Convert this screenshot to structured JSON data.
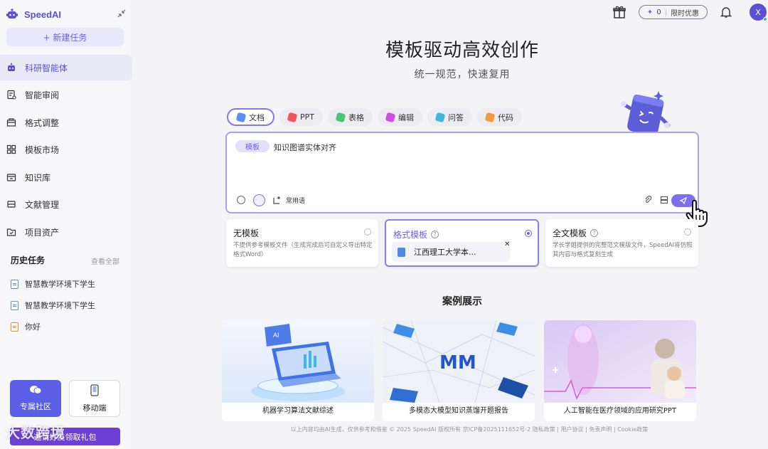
{
  "app": {
    "name": "SpeedAI"
  },
  "sidebar": {
    "new_task": "+ 新建任务",
    "items": [
      {
        "label": "科研智能体",
        "icon": "robot-icon"
      },
      {
        "label": "智能审阅",
        "icon": "review-icon"
      },
      {
        "label": "格式调整",
        "icon": "format-icon"
      },
      {
        "label": "模板市场",
        "icon": "template-market-icon"
      },
      {
        "label": "知识库",
        "icon": "knowledge-icon"
      },
      {
        "label": "文献管理",
        "icon": "literature-icon"
      },
      {
        "label": "项目资产",
        "icon": "assets-icon"
      }
    ],
    "history_title": "历史任务",
    "history_all": "查看全部",
    "history": [
      {
        "label": "智慧教学环境下学生"
      },
      {
        "label": "智慧教学环境下学生"
      },
      {
        "label": "你好"
      }
    ],
    "community": "专属社区",
    "mobile": "移动端",
    "promo": "邀请好友领取礼包",
    "watermark": "大数跨境"
  },
  "topbar": {
    "credits": "0",
    "offer": "限时优惠",
    "avatar": "X"
  },
  "hero": {
    "title": "模板驱动高效创作",
    "subtitle": "统一规范，快速复用"
  },
  "tabs": [
    {
      "label": "文档",
      "color": "#5b8ef0",
      "active": true
    },
    {
      "label": "PPT",
      "color": "#f0575c"
    },
    {
      "label": "表格",
      "color": "#4cc474"
    },
    {
      "label": "编辑",
      "color": "#d04fe0"
    },
    {
      "label": "问答",
      "color": "#41b8d8"
    },
    {
      "label": "代码",
      "color": "#f39a3c"
    }
  ],
  "input": {
    "tag": "模板",
    "text": "知识图谱实体对齐",
    "phrase": "常用语"
  },
  "templates": [
    {
      "title": "无模板",
      "desc": "不提供参考模板文件（生成完成后可自定义导出特定格式Word）",
      "selected": false
    },
    {
      "title": "格式模板",
      "file": "江西理工大学本...",
      "selected": true
    },
    {
      "title": "全文模板",
      "desc": "学长学姐提供的完整范文模版文件，SpeedAI将仿照其内容与格式复刻生成",
      "selected": false
    }
  ],
  "cases": {
    "title": "案例展示",
    "items": [
      {
        "caption": "机器学习算法文献综述"
      },
      {
        "caption": "多模态大模型知识蒸馏开题报告"
      },
      {
        "caption": "人工智能在医疗领域的应用研究PPT"
      }
    ]
  },
  "footer": "以上内容均由AI生成，仅供参考和借鉴   © 2025 SpeedAI 版权所有 京ICP备2025111652号-2   隐私政策 | 用户协议 | 免责声明 | Cookie政策",
  "colors": {
    "accent": "#6a5ff0",
    "sidebar_bg": "#f7f7f9"
  }
}
